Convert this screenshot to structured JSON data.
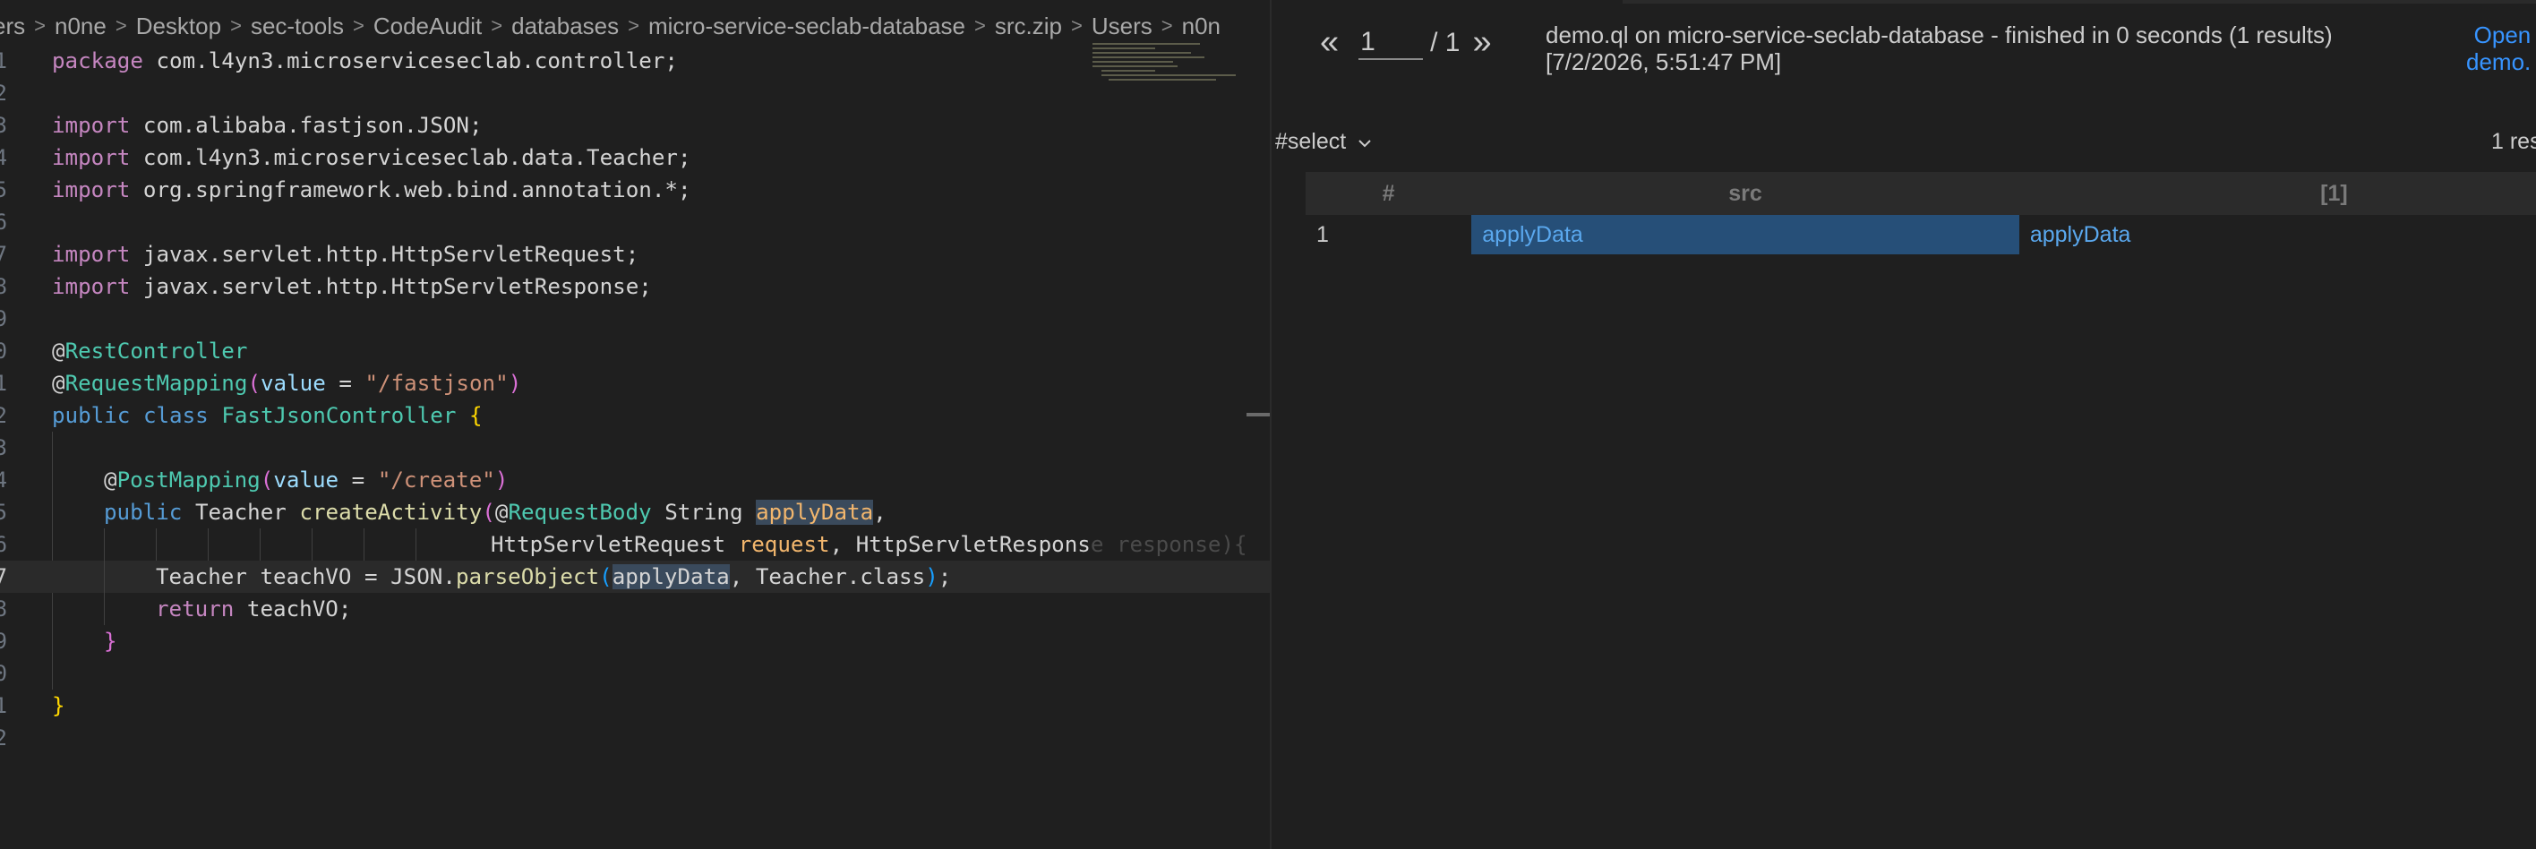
{
  "breadcrumb": [
    "ers",
    "n0ne",
    "Desktop",
    "sec-tools",
    "CodeAudit",
    "databases",
    "micro-service-seclab-database",
    "src.zip",
    "Users",
    "n0n"
  ],
  "code": {
    "line_numbers": [
      "1",
      "2",
      "3",
      "4",
      "5",
      "6",
      "7",
      "8",
      "9",
      "0",
      "1",
      "2",
      "3",
      "4",
      "5",
      "6",
      "7",
      "8",
      "9",
      "0",
      "1",
      "2"
    ],
    "l1": {
      "kw": "package",
      "rest": " com.l4yn3.microserviceseclab.controller;"
    },
    "l3": {
      "kw": "import",
      "rest": " com.alibaba.fastjson.JSON;"
    },
    "l4": {
      "kw": "import",
      "rest": " com.l4yn3.microserviceseclab.data.Teacher;"
    },
    "l5": {
      "kw": "import",
      "rest": " org.springframework.web.bind.annotation.*;"
    },
    "l7": {
      "kw": "import",
      "rest": " javax.servlet.http.HttpServletRequest;"
    },
    "l8": {
      "kw": "import",
      "rest": " javax.servlet.http.HttpServletResponse;"
    },
    "l10": {
      "at": "@",
      "anno": "RestController"
    },
    "l11": {
      "at": "@",
      "anno": "RequestMapping",
      "open": "(",
      "param": "value",
      "eq": " = ",
      "str": "\"/fastjson\"",
      "close": ")"
    },
    "l12": {
      "kw1": "public",
      "kw2": "class",
      "type": "FastJsonController",
      "brace": "{"
    },
    "l14": {
      "at": "@",
      "anno": "PostMapping",
      "open": "(",
      "param": "value",
      "eq": " = ",
      "str": "\"/create\"",
      "close": ")"
    },
    "l15": {
      "kw": "public",
      "ret": "Teacher",
      "fn": "createActivity",
      "open": "(",
      "at": "@",
      "anno": "RequestBody",
      "ptype": "String",
      "pname": "applyData",
      "comma": ","
    },
    "l16": {
      "t1": "HttpServletRequest",
      "p1": "request",
      "sep": ", ",
      "t2": "HttpServletRespons",
      "ghost": "e response){"
    },
    "l17": {
      "pre": "Teacher teachVO = JSON.",
      "fn": "parseObject",
      "open": "(",
      "arg": "applyData",
      "post": ", Teacher.class",
      "close": ")",
      "semi": ";"
    },
    "l18": {
      "kw": "return",
      "rest": " teachVO;"
    },
    "l19": {
      "brace": "}"
    },
    "l21": {
      "brace": "}"
    }
  },
  "results": {
    "pager": {
      "prev_label": "«",
      "current_page": "1",
      "total_label": "/ 1",
      "next_label": "»"
    },
    "query_info_line1": "demo.ql on micro-service-seclab-database - finished in 0 seconds (1 results)",
    "query_info_line2": "[7/2/2026, 5:51:47 PM]",
    "open_link_line1": "Open",
    "open_link_line2": "demo.",
    "select_label": "#select",
    "count_label": "1 res",
    "table": {
      "headers": [
        "#",
        "src",
        "[1]"
      ],
      "rows": [
        {
          "index": "1",
          "src": "applyData",
          "col1": "applyData"
        }
      ]
    }
  },
  "colors": {
    "editor_bg": "#1f1f1f",
    "keyword": "#569cd6",
    "annotation": "#4ec9b0",
    "string": "#ce9178",
    "link": "#5aa8ee",
    "selection": "#264f78"
  }
}
